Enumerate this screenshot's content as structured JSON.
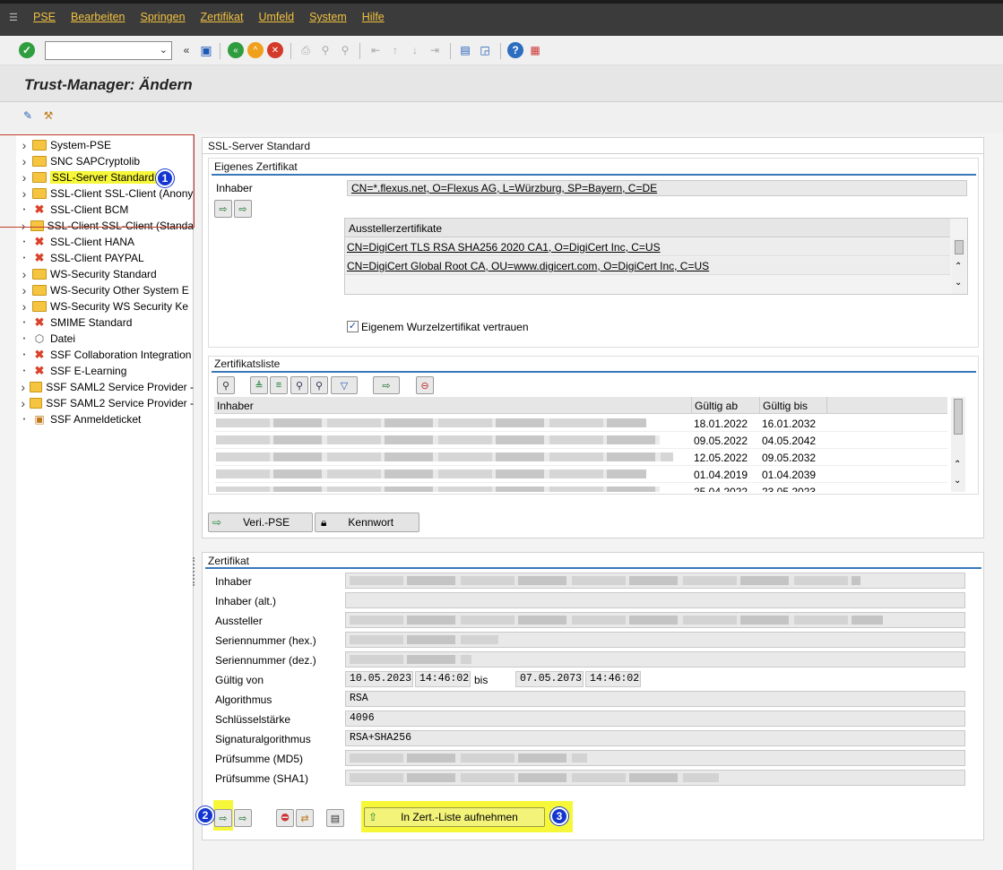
{
  "menu": {
    "items": [
      "PSE",
      "Bearbeiten",
      "Springen",
      "Zertifikat",
      "Umfeld",
      "System",
      "Hilfe"
    ]
  },
  "title": "Trust-Manager: Ändern",
  "tree": {
    "items": [
      {
        "label": "System-PSE",
        "icon": "folder",
        "expand": true
      },
      {
        "label": "SNC SAPCryptolib",
        "icon": "folder",
        "expand": true
      },
      {
        "label": "SSL-Server Standard",
        "icon": "folder",
        "expand": true
      },
      {
        "label": "SSL-Client SSL-Client (Anony",
        "icon": "folder",
        "expand": true
      },
      {
        "label": "SSL-Client BCM",
        "icon": "x",
        "expand": false
      },
      {
        "label": "SSL-Client SSL-Client (Standa",
        "icon": "folder",
        "expand": true
      },
      {
        "label": "SSL-Client HANA",
        "icon": "x",
        "expand": false
      },
      {
        "label": "SSL-Client PAYPAL",
        "icon": "x",
        "expand": false
      },
      {
        "label": "WS-Security Standard",
        "icon": "folder",
        "expand": true
      },
      {
        "label": "WS-Security Other System E",
        "icon": "folder",
        "expand": true
      },
      {
        "label": "WS-Security WS Security Ke",
        "icon": "folder",
        "expand": true
      },
      {
        "label": "SMIME Standard",
        "icon": "x",
        "expand": false
      },
      {
        "label": "Datei",
        "icon": "cube",
        "expand": false
      },
      {
        "label": "SSF Collaboration Integration",
        "icon": "x",
        "expand": false
      },
      {
        "label": "SSF E-Learning",
        "icon": "x",
        "expand": false
      },
      {
        "label": "SSF SAML2 Service Provider -",
        "icon": "folder",
        "expand": true
      },
      {
        "label": "SSF SAML2 Service Provider -",
        "icon": "folder",
        "expand": true
      },
      {
        "label": "SSF Anmeldeticket",
        "icon": "doc",
        "expand": false
      }
    ],
    "badge1": "1"
  },
  "pse": {
    "title": "SSL-Server Standard",
    "own_cert_title": "Eigenes Zertifikat",
    "owner_label": "Inhaber",
    "owner_value": "CN=*.flexus.net, O=Flexus AG, L=Würzburg, SP=Bayern, C=DE",
    "issuer_certs_header": "Ausstellerzertifikate",
    "issuer_certs": [
      "CN=DigiCert TLS RSA SHA256 2020 CA1, O=DigiCert Inc, C=US",
      "CN=DigiCert Global Root CA, OU=www.digicert.com, O=DigiCert Inc, C=US"
    ],
    "trust_root_label": "Eigenem Wurzelzertifikat vertrauen"
  },
  "certlist": {
    "title": "Zertifikatsliste",
    "columns": [
      "Inhaber",
      "Gültig ab",
      "Gültig bis"
    ],
    "rows": [
      {
        "from": "18.01.2022",
        "to": "16.01.2032"
      },
      {
        "from": "09.05.2022",
        "to": "04.05.2042"
      },
      {
        "from": "12.05.2022",
        "to": "09.05.2032"
      },
      {
        "from": "01.04.2019",
        "to": "01.04.2039"
      },
      {
        "from": "25.04.2022",
        "to": "23.05.2023"
      }
    ],
    "veri_btn": "Veri.-PSE",
    "password_btn": "Kennwort"
  },
  "cert": {
    "title": "Zertifikat",
    "labels": {
      "owner": "Inhaber",
      "owner_alt": "Inhaber (alt.)",
      "issuer": "Aussteller",
      "serial_hex": "Seriennummer (hex.)",
      "serial_dec": "Seriennummer (dez.)",
      "valid_from": "Gültig von",
      "algorithm": "Algorithmus",
      "key_strength": "Schlüsselstärke",
      "sig_algorithm": "Signaturalgorithmus",
      "md5": "Prüfsumme (MD5)",
      "sha1": "Prüfsumme (SHA1)"
    },
    "valid_from_date": "10.05.2023",
    "valid_from_time": "14:46:02",
    "bis": "bis",
    "valid_to_date": "07.05.2073",
    "valid_to_time": "14:46:02",
    "algorithm": "RSA",
    "key_strength": "4096",
    "sig_algorithm": "RSA+SHA256",
    "add_btn": "In Zert.-Liste aufnehmen",
    "badge2": "2",
    "badge3": "3"
  }
}
